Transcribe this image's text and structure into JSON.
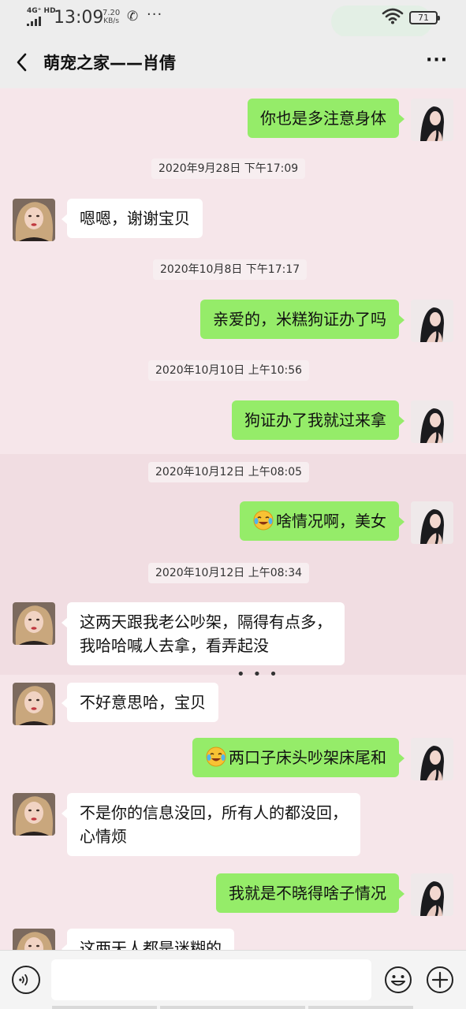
{
  "status_bar": {
    "network": "4G⁺ HD",
    "time": "13:09",
    "speed_value": "7.20",
    "speed_unit": "KB/s",
    "more": "···",
    "battery": "71"
  },
  "header": {
    "title": "萌宠之家——肖倩",
    "more": "···"
  },
  "timestamps": [
    "2020年9月28日 下午17:09",
    "2020年10月8日 下午17:17",
    "2020年10月10日 上午10:56",
    "2020年10月12日 上午08:05",
    "2020年10月12日 上午08:34"
  ],
  "messages": [
    {
      "sender": "me",
      "text": "你也是多注意身体"
    },
    {
      "sender": "them",
      "text": "嗯嗯，谢谢宝贝"
    },
    {
      "sender": "me",
      "text": "亲爱的，米糕狗证办了吗"
    },
    {
      "sender": "me",
      "text": "狗证办了我就过来拿"
    },
    {
      "sender": "me",
      "text": "啥情况啊，美女",
      "emoji": "crying-laughing"
    },
    {
      "sender": "them",
      "text_line1": "这两天跟我老公吵架，隔得有点多，",
      "text_line2": "我哈哈喊人去拿，看弄起没"
    },
    {
      "sender": "them",
      "text": "不好意思哈，宝贝"
    },
    {
      "sender": "me",
      "text": "两口子床头吵架床尾和",
      "emoji": "crying-laughing"
    },
    {
      "sender": "them",
      "text_line1": "不是你的信息没回，所有人的都没回，",
      "text_line2": "心情烦"
    },
    {
      "sender": "me",
      "text": "我就是不晓得啥子情况"
    },
    {
      "sender": "them",
      "text": "这两天人都是迷糊的"
    }
  ],
  "typing_indicator": "•••",
  "input": {
    "placeholder": "",
    "value": ""
  },
  "colors": {
    "chat_background": "#f6e6ea",
    "my_bubble": "#95ec69",
    "their_bubble": "#ffffff",
    "bar_background": "#ededed"
  }
}
